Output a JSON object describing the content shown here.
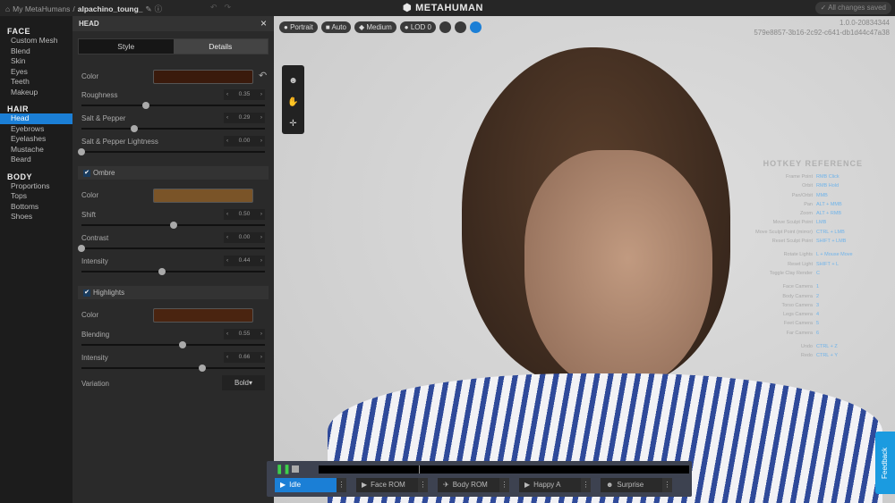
{
  "topbar": {
    "breadcrumb_root": "My MetaHumans",
    "separator": "/",
    "project": "alpachino_toung_",
    "app_title": "METAHUMAN",
    "save_status": "All changes saved"
  },
  "sidebar": {
    "sections": [
      {
        "title": "FACE",
        "items": [
          "Custom Mesh",
          "Blend",
          "Skin",
          "Eyes",
          "Teeth",
          "Makeup"
        ]
      },
      {
        "title": "HAIR",
        "items": [
          "Head",
          "Eyebrows",
          "Eyelashes",
          "Mustache",
          "Beard"
        ]
      },
      {
        "title": "BODY",
        "items": [
          "Proportions",
          "Tops",
          "Bottoms",
          "Shoes"
        ]
      }
    ],
    "active": "Head"
  },
  "panel": {
    "title": "HEAD",
    "tabs": [
      "Style",
      "Details"
    ],
    "active_tab": "Details",
    "color_label": "Color",
    "color": "#3a1a0c",
    "sliders": [
      {
        "label": "Roughness",
        "value": 0.35,
        "display": "0.35"
      },
      {
        "label": "Salt & Pepper",
        "value": 0.29,
        "display": "0.29"
      },
      {
        "label": "Salt & Pepper Lightness",
        "value": 0.0,
        "display": "0.00"
      }
    ],
    "ombre": {
      "label": "Ombre",
      "checked": true,
      "color_label": "Color",
      "color": "#7a5428",
      "sliders": [
        {
          "label": "Shift",
          "value": 0.5,
          "display": "0.50"
        },
        {
          "label": "Contrast",
          "value": 0.0,
          "display": "0.00"
        },
        {
          "label": "Intensity",
          "value": 0.44,
          "display": "0.44"
        }
      ]
    },
    "highlights": {
      "label": "Highlights",
      "checked": true,
      "color_label": "Color",
      "color": "#4a2410",
      "sliders": [
        {
          "label": "Blending",
          "value": 0.55,
          "display": "0.55"
        },
        {
          "label": "Intensity",
          "value": 0.66,
          "display": "0.66"
        }
      ]
    },
    "variation_label": "Variation",
    "variation_value": "Bold"
  },
  "viewport": {
    "pills": [
      "Portrait",
      "Auto",
      "Medium",
      "LOD 0"
    ],
    "version": "1.0.0-20834344",
    "id": "579e8857-3b16-2c92-c641-db1d44c47a38",
    "hotkeys": {
      "title": "HOTKEY REFERENCE",
      "groups": [
        [
          [
            "Frame Point",
            "RMB Click"
          ],
          [
            "Orbit",
            "RMB Hold"
          ],
          [
            "Pan/Orbit",
            "MMB"
          ],
          [
            "Pan",
            "ALT + MMB"
          ],
          [
            "Zoom",
            "ALT + RMB"
          ],
          [
            "Move Sculpt Point",
            "LMB"
          ],
          [
            "Move Sculpt Point (mirror)",
            "CTRL + LMB"
          ],
          [
            "Reset Sculpt Point",
            "SHIFT + LMB"
          ]
        ],
        [
          [
            "Rotate Lights",
            "L + Mouse Move"
          ],
          [
            "Reset Light",
            "SHIFT + L"
          ],
          [
            "Toggle Clay Render",
            "C"
          ]
        ],
        [
          [
            "Face Camera",
            "1"
          ],
          [
            "Body Camera",
            "2"
          ],
          [
            "Torso Camera",
            "3"
          ],
          [
            "Legs Camera",
            "4"
          ],
          [
            "Feet Camera",
            "5"
          ],
          [
            "Far Camera",
            "6"
          ]
        ],
        [
          [
            "Undo",
            "CTRL + Z"
          ],
          [
            "Redo",
            "CTRL + Y"
          ]
        ]
      ]
    },
    "feedback": "Feedback"
  },
  "player": {
    "progress": 0.27,
    "animations": [
      "Idle",
      "Face ROM",
      "Body ROM",
      "Happy A",
      "Surprise"
    ],
    "active": "Idle"
  }
}
